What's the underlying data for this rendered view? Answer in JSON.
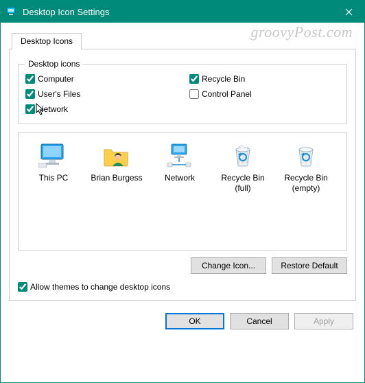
{
  "window": {
    "title": "Desktop Icon Settings"
  },
  "watermark": "groovyPost.com",
  "tabs": [
    {
      "label": "Desktop Icons"
    }
  ],
  "group": {
    "legend": "Desktop icons",
    "checks": [
      {
        "label": "Computer",
        "checked": true
      },
      {
        "label": "Recycle Bin",
        "checked": true
      },
      {
        "label": "User's Files",
        "checked": true
      },
      {
        "label": "Control Panel",
        "checked": false
      },
      {
        "label": "Network",
        "checked": true
      }
    ]
  },
  "icons": [
    {
      "label": "This PC",
      "icon": "monitor-icon"
    },
    {
      "label": "Brian Burgess",
      "icon": "userfiles-icon"
    },
    {
      "label": "Network",
      "icon": "network-icon"
    },
    {
      "label": "Recycle Bin\n(full)",
      "icon": "bin-full-icon"
    },
    {
      "label": "Recycle Bin\n(empty)",
      "icon": "bin-empty-icon"
    }
  ],
  "buttons": {
    "change_icon": "Change Icon...",
    "restore_default": "Restore Default"
  },
  "allow_themes": {
    "label": "Allow themes to change desktop icons",
    "checked": true
  },
  "footer": {
    "ok": "OK",
    "cancel": "Cancel",
    "apply": "Apply"
  }
}
